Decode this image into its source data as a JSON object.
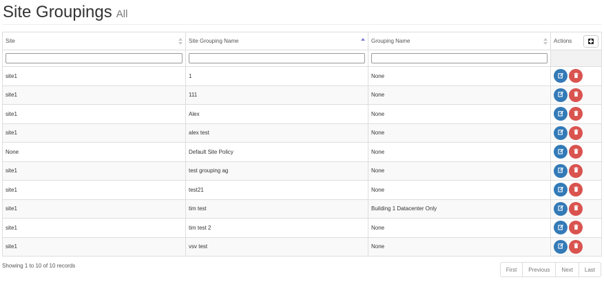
{
  "header": {
    "title": "Site Groupings",
    "subtitle": "All"
  },
  "table": {
    "columns": [
      {
        "label": "Site",
        "sort": "none"
      },
      {
        "label": "Site Grouping Name",
        "sort": "asc"
      },
      {
        "label": "Grouping Name",
        "sort": "none"
      },
      {
        "label": "Actions"
      }
    ],
    "filters": [
      "",
      "",
      ""
    ],
    "rows": [
      {
        "site": "site1",
        "site_grouping_name": "1",
        "grouping_name": "None"
      },
      {
        "site": "site1",
        "site_grouping_name": "111",
        "grouping_name": "None"
      },
      {
        "site": "site1",
        "site_grouping_name": "Alex",
        "grouping_name": "None"
      },
      {
        "site": "site1",
        "site_grouping_name": "alex test",
        "grouping_name": "None"
      },
      {
        "site": "None",
        "site_grouping_name": "Default Site Policy",
        "grouping_name": "None"
      },
      {
        "site": "site1",
        "site_grouping_name": "test grouping ag",
        "grouping_name": "None"
      },
      {
        "site": "site1",
        "site_grouping_name": "test21",
        "grouping_name": "None"
      },
      {
        "site": "site1",
        "site_grouping_name": "tim test",
        "grouping_name": "Building 1 Datacenter Only"
      },
      {
        "site": "site1",
        "site_grouping_name": "tim test 2",
        "grouping_name": "None"
      },
      {
        "site": "site1",
        "site_grouping_name": "vsv test",
        "grouping_name": "None"
      }
    ]
  },
  "icons": {
    "add": "plus-square-icon",
    "edit": "edit-icon",
    "delete": "trash-icon"
  },
  "colors": {
    "edit": "#337ab7",
    "delete": "#d9534f",
    "sort_active": "#7b7bd6"
  },
  "footer": {
    "info": "Showing 1 to 10 of 10 records",
    "pager": {
      "first": "First",
      "previous": "Previous",
      "next": "Next",
      "last": "Last"
    }
  }
}
